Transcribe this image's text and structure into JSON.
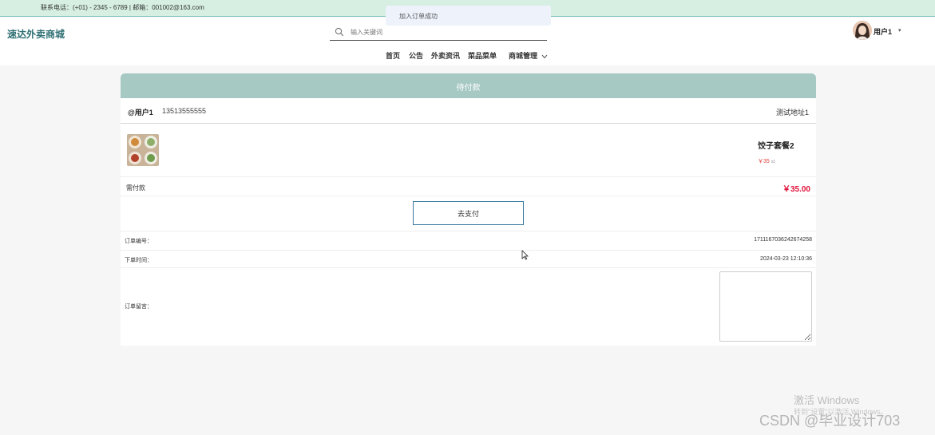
{
  "topbar": {
    "contact": "联系电话：(+01) - 2345 - 6789 | 邮箱：001002@163.com"
  },
  "toast": {
    "message": "加入订单成功"
  },
  "header": {
    "logo": "速达外卖商城",
    "search_placeholder": "输入关键词",
    "user_name": "用户1",
    "user_caret": "▾"
  },
  "nav": {
    "items": [
      {
        "label": "首页"
      },
      {
        "label": "公告"
      },
      {
        "label": "外卖资讯"
      },
      {
        "label": "菜品菜单"
      },
      {
        "label": "商城管理"
      }
    ]
  },
  "order": {
    "status": "待付款",
    "address": {
      "name": "@用户1",
      "phone": "13513555555",
      "detail": "测试地址1"
    },
    "goods": {
      "name": "饺子套餐2",
      "price": "￥35",
      "qty": "x1"
    },
    "pay_label": "需付款",
    "pay_amount": "￥35.00",
    "pay_button": "去支付",
    "number_label": "订单编号：",
    "number_value": "1711167036242674258",
    "time_label": "下单时间：",
    "time_value": "2024-03-23 12:10:36",
    "remark_label": "订单留言："
  },
  "watermarks": {
    "windows": "激活 Windows",
    "windows_sub": "转到\"设置\"以激活 Windows。",
    "csdn": "CSDN @毕业设计703"
  },
  "colors": {
    "topbar_bg": "#d6efe2",
    "logo": "#2f6f73",
    "status_bar": "#a6c9c4",
    "price_red": "#e0143c"
  }
}
